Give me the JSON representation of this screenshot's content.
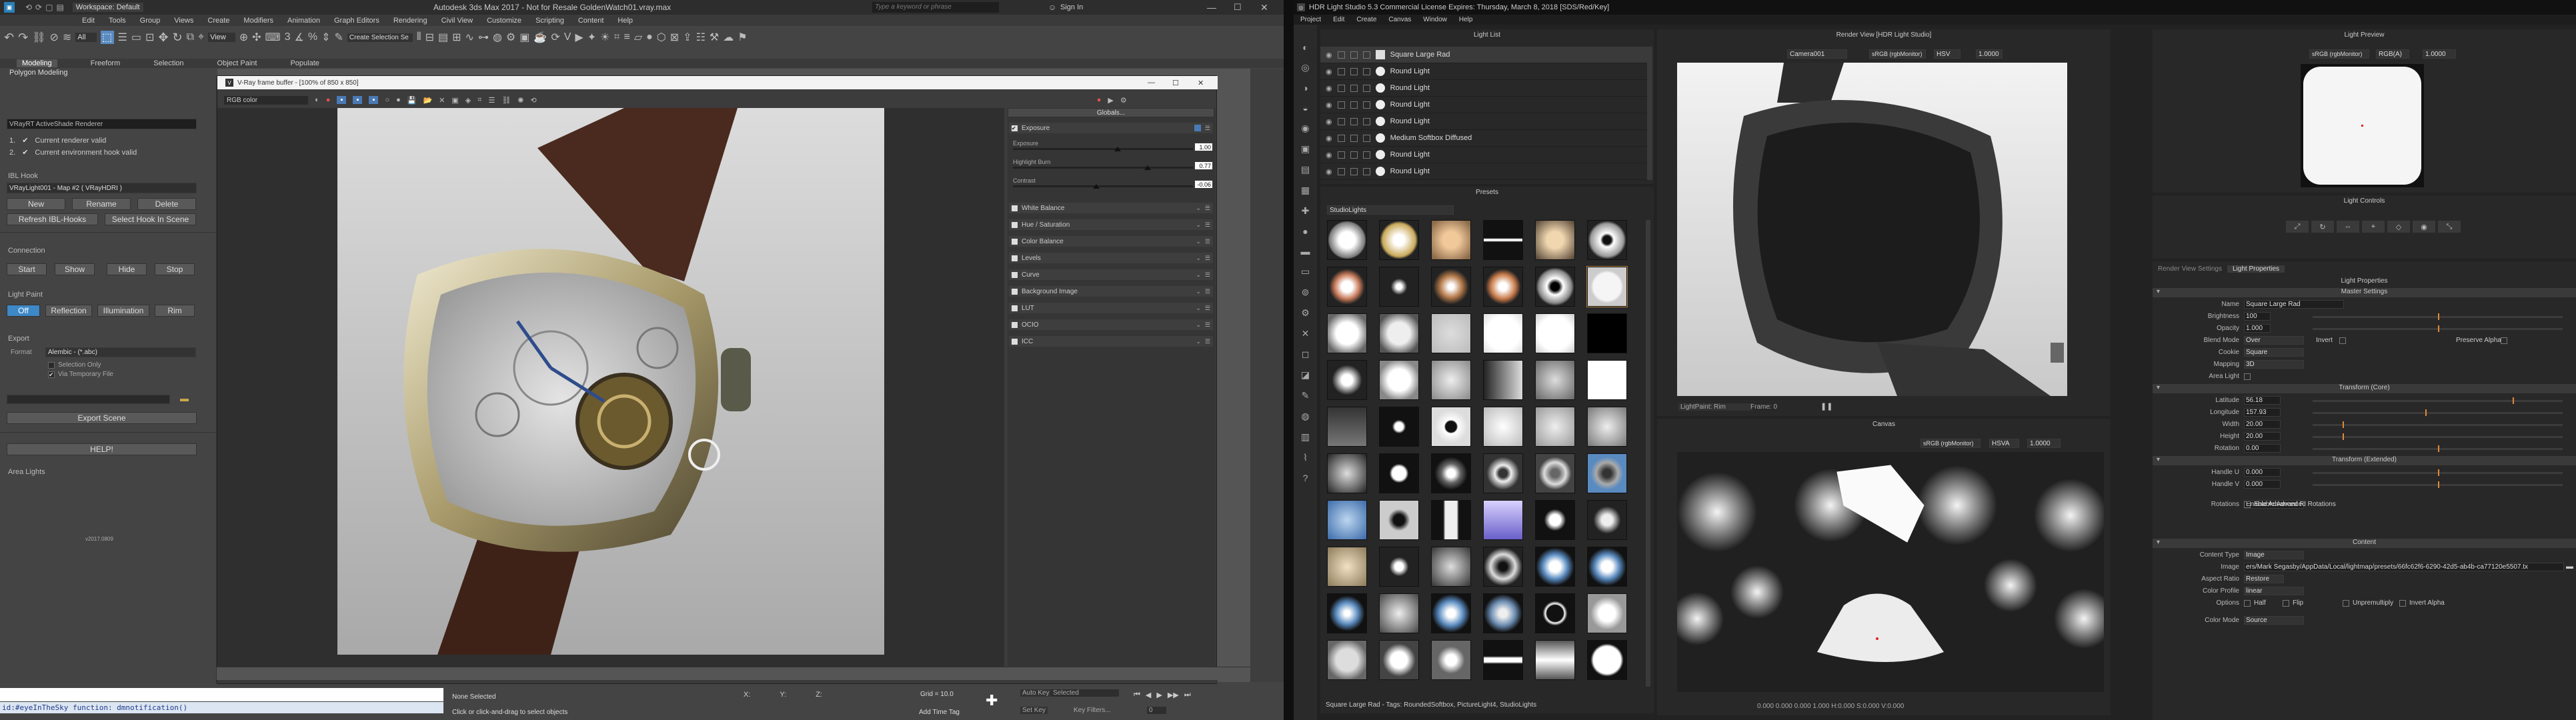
{
  "max": {
    "title": "Autodesk 3ds Max 2017 - Not for Resale   GoldenWatch01.vray.max",
    "workspace": "Workspace: Default",
    "search_placeholder": "Type a keyword or phrase",
    "sign_in": "Sign In",
    "menus": [
      "Edit",
      "Tools",
      "Group",
      "Views",
      "Create",
      "Modifiers",
      "Animation",
      "Graph Editors",
      "Rendering",
      "Civil View",
      "Customize",
      "Scripting",
      "Content",
      "Help"
    ],
    "toolbar": {
      "all": "All",
      "view": "View",
      "selection_set": "Create Selection Se"
    },
    "ribbon_tabs": [
      "Modeling",
      "Freeform",
      "Selection",
      "Object Paint",
      "Populate"
    ],
    "ribbon_sub": "Polygon Modeling",
    "panel": {
      "renderer_box": "VRayRT ActiveShade Renderer",
      "status": [
        {
          "num": "1.",
          "text": "Current renderer valid"
        },
        {
          "num": "2.",
          "text": "Current environment hook valid"
        }
      ],
      "ibl_hook": "IBL Hook",
      "ibl_map": "VRayLight001 - Map #2  ( VRayHDRI )",
      "buttons1": [
        "New",
        "Rename",
        "Delete"
      ],
      "buttons2": [
        "Refresh IBL-Hooks",
        "Select Hook In Scene"
      ],
      "connection": "Connection",
      "conn_buttons": [
        "Start",
        "Show",
        "Hide",
        "Stop"
      ],
      "light_paint": "Light Paint",
      "paint_buttons": [
        "Off",
        "Reflection",
        "Illumination",
        "Rim"
      ],
      "export": "Export",
      "format_label": "Format",
      "format_value": "Alembic - (*.abc)",
      "check1": "Selection Only",
      "check2": "Via Temporary File",
      "export_scene": "Export Scene",
      "help": "HELP!",
      "area_lights": "Area Lights",
      "version": "v2017.0809"
    },
    "script": "id:#eyeInTheSky   function: dmnotification()",
    "status": {
      "none_selected": "None Selected",
      "hint": "Click or click-and-drag to select objects",
      "x": "X:",
      "y": "Y:",
      "z": "Z:",
      "grid": "Grid = 10.0",
      "auto_key": "Auto Key",
      "set_key": "Set Key",
      "selected": "Selected",
      "key_filters": "Key Filters...",
      "add_time_tag": "Add Time Tag",
      "frame": "0"
    }
  },
  "vfb": {
    "title": "V-Ray frame buffer - [100% of 850 x 850]",
    "channel": "RGB color",
    "globals": "Globals...",
    "corrections": [
      {
        "name": "Exposure",
        "checked": true
      },
      {
        "name": "White Balance",
        "checked": false
      },
      {
        "name": "Hue / Saturation",
        "checked": false
      },
      {
        "name": "Color Balance",
        "checked": false
      },
      {
        "name": "Levels",
        "checked": false
      },
      {
        "name": "Curve",
        "checked": false
      },
      {
        "name": "Background Image",
        "checked": false
      },
      {
        "name": "LUT",
        "checked": false
      },
      {
        "name": "OCIO",
        "checked": false
      },
      {
        "name": "ICC",
        "checked": false
      }
    ],
    "exposure": {
      "label": "Exposure",
      "value": "1.00"
    },
    "highlight": {
      "label": "Highlight Burn",
      "value": "0.77"
    },
    "contrast": {
      "label": "Contrast",
      "value": "-0.06"
    }
  },
  "hdr": {
    "title": "HDR Light Studio 5.3 Commercial License Expires: Thursday, March 8, 2018 [SDS/Red/Key]",
    "menus": [
      "Project",
      "Edit",
      "Create",
      "Canvas",
      "Window",
      "Help"
    ],
    "light_list_title": "Light List",
    "lights": [
      "Square Large Rad",
      "Round Light",
      "Round Light",
      "Round Light",
      "Round Light",
      "Medium Softbox Diffused",
      "Round Light",
      "Round Light"
    ],
    "presets_title": "Presets",
    "preset_category": "StudioLights",
    "preset_status": "Square Large Rad - Tags: RoundedSoftbox, PictureLight4, StudioLights",
    "render_view_title": "Render View [HDR Light Studio]",
    "camera": "Camera001",
    "color_space": "sRGB (rgbMonitor)",
    "hsv": "HSV",
    "gain": "1.0000",
    "light_paint": "LightPaint: Rim",
    "frame": "Frame: 0",
    "canvas_title": "Canvas",
    "canvas_color": "sRGB (rgbMonitor)",
    "hsva": "HSVA",
    "canvas_gain": "1.0000",
    "canvas_coords": "0.000 0.000 0.000   1.000    H:0.000 S:0.000 V:0.000",
    "preview_title": "Light Preview",
    "preview_color": "sRGB (rgbMonitor)",
    "preview_ch": "RGB(A)",
    "preview_gain": "1.0000",
    "controls_title": "Light Controls",
    "tabs": [
      "Render View Settings",
      "Light Properties"
    ],
    "props_title": "Light Properties",
    "sections": {
      "master": "Master Settings",
      "transform_core": "Transform (Core)",
      "transform_ext": "Transform (Extended)",
      "content": "Content"
    },
    "props": {
      "name": {
        "label": "Name",
        "value": "Square Large Rad"
      },
      "brightness": {
        "label": "Brightness",
        "value": "100"
      },
      "opacity": {
        "label": "Opacity",
        "value": "1.000"
      },
      "blend": {
        "label": "Blend Mode",
        "value": "Over",
        "invert": "Invert",
        "preserve": "Preserve Alpha"
      },
      "cookie": {
        "label": "Cookie",
        "value": "Square"
      },
      "mapping": {
        "label": "Mapping",
        "value": "3D"
      },
      "area": {
        "label": "Area Light"
      },
      "latitude": {
        "label": "Latitude",
        "value": "56.18",
        "pct": 0.8
      },
      "longitude": {
        "label": "Longitude",
        "value": "157.93",
        "pct": 0.45
      },
      "width": {
        "label": "Width",
        "value": "20.00",
        "pct": 0.12
      },
      "height": {
        "label": "Height",
        "value": "20.00",
        "pct": 0.12
      },
      "rotation": {
        "label": "Rotation",
        "value": "0.00",
        "pct": 0.5
      },
      "handle_u": {
        "label": "Handle U",
        "value": "0.000"
      },
      "handle_v": {
        "label": "Handle V",
        "value": "0.000"
      },
      "rotations": {
        "label": "Rotations",
        "value": "Enable Advanced Rotations"
      },
      "content_type": {
        "label": "Content Type",
        "value": "Image"
      },
      "image": {
        "label": "Image",
        "value": "ers/Mark Segasby/AppData/Local/lightmap/presets/66fc62f6-6290-42d5-ab4b-ca77120e5507.tx"
      },
      "aspect": {
        "label": "Aspect Ratio",
        "value": "Restore"
      },
      "color_profile": {
        "label": "Color Profile",
        "value": "linear"
      },
      "options": {
        "label": "Options",
        "half": "Half",
        "flip": "Flip",
        "unpremult": "Unpremultiply",
        "invert_alpha": "Invert Alpha"
      },
      "color_mode": {
        "label": "Color Mode",
        "value": "Source"
      }
    }
  }
}
